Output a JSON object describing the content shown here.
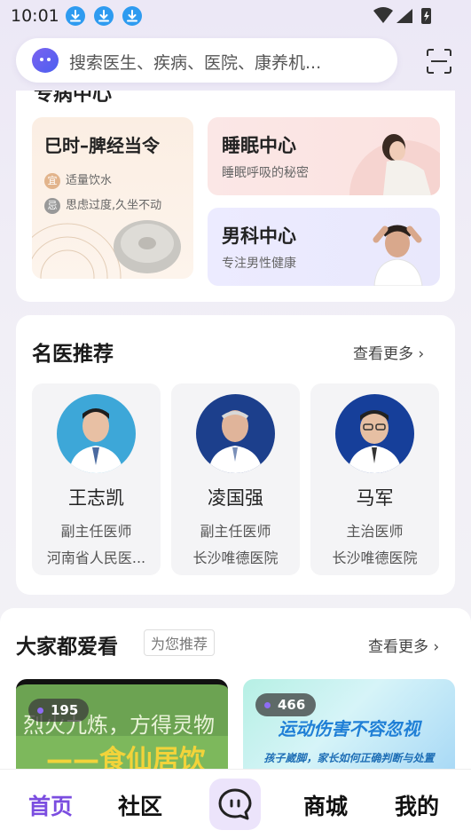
{
  "status_bar": {
    "time": "10:01"
  },
  "search": {
    "placeholder": "搜索医生、疾病、医院、康养机..."
  },
  "centers": {
    "partial_title": "专病中心",
    "seasonal": {
      "title": "巳时–脾经当令",
      "tips": [
        {
          "badge": "宜",
          "text": "适量饮水"
        },
        {
          "badge": "忌",
          "text": "思虑过度,久坐不动"
        }
      ]
    },
    "items": [
      {
        "title": "睡眠中心",
        "subtitle": "睡眠呼吸的秘密"
      },
      {
        "title": "男科中心",
        "subtitle": "专注男性健康"
      }
    ]
  },
  "doctors": {
    "title": "名医推荐",
    "more": "查看更多",
    "list": [
      {
        "name": "王志凯",
        "title": "副主任医师",
        "hospital": "河南省人民医..."
      },
      {
        "name": "凌国强",
        "title": "副主任医师",
        "hospital": "长沙唯德医院"
      },
      {
        "name": "马军",
        "title": "主治医师",
        "hospital": "长沙唯德医院"
      }
    ]
  },
  "popular": {
    "title": "大家都爱看",
    "tag": "为您推荐",
    "more": "查看更多",
    "videos": [
      {
        "views": "195",
        "caption_line1": "烈火九炼，方得灵物",
        "caption_line2": "——食仙居饮"
      },
      {
        "views": "466",
        "caption_line1": "运动伤害不容忽视",
        "caption_line2": "孩子崴脚，家长如何正确判断与处置"
      }
    ]
  },
  "tabs": [
    {
      "label": "首页",
      "active": true
    },
    {
      "label": "社区",
      "active": false
    },
    {
      "label": "商城",
      "active": false
    },
    {
      "label": "我的",
      "active": false
    }
  ],
  "colors": {
    "accent": "#7b4de0",
    "download_badge": "#2e9bf0"
  }
}
